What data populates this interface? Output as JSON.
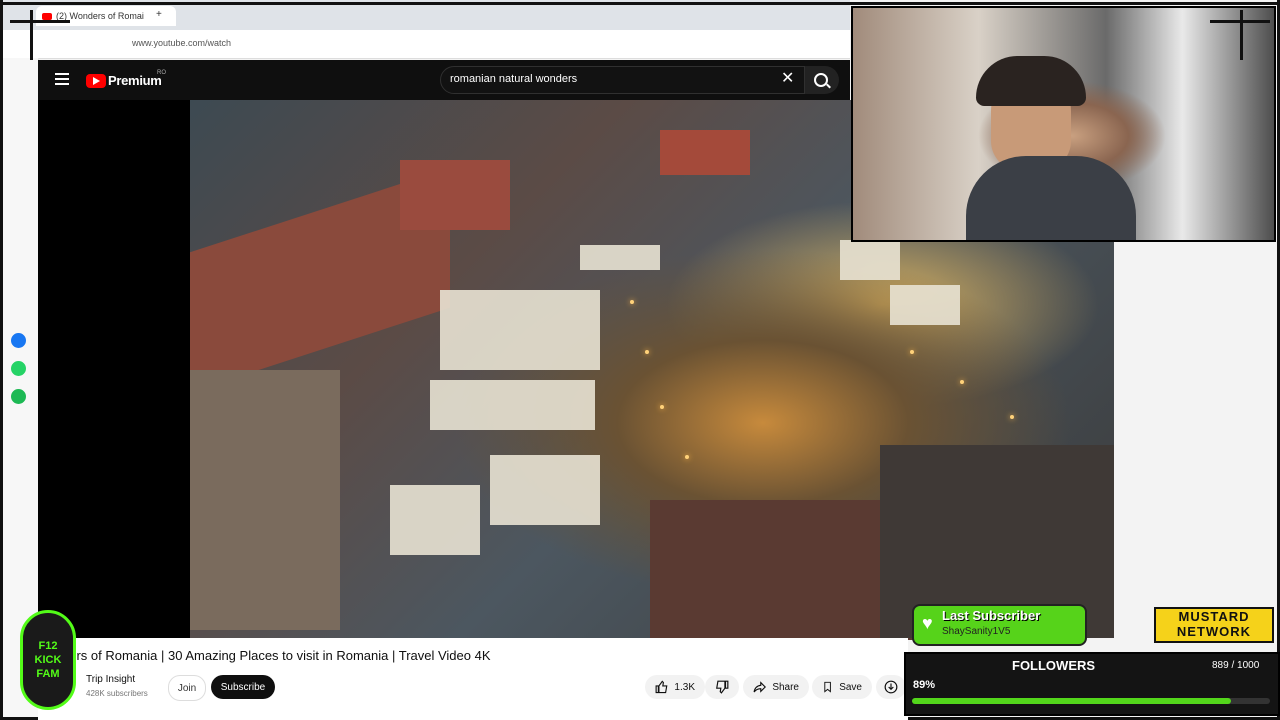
{
  "browser": {
    "tab_title": "(2) Wonders of Romai",
    "new_tab": "+",
    "url": "www.youtube.com/watch"
  },
  "youtube": {
    "brand": "Premium",
    "region": "RO",
    "search_query": "romanian natural wonders",
    "video_title": "ders of Romania | 30 Amazing Places to visit in Romania | Travel Video 4K",
    "channel_name": "Trip Insight",
    "subscribers": "428K subscribers",
    "join_label": "Join",
    "subscribe_label": "Subscribe",
    "likes": "1.3K",
    "share_label": "Share",
    "save_label": "Save"
  },
  "overlay": {
    "kick_badge_line1": "F12",
    "kick_badge_line2": "KICK FAM",
    "last_subscriber_title": "Last Subscriber",
    "last_subscriber_name": "ShaySanity1V5",
    "mustard_logo_line1": "MUSTARD",
    "mustard_logo_line2": "NETWORK",
    "followers_title": "FOLLOWERS",
    "followers_count": "889 / 1000",
    "followers_percent": "89%",
    "followers_progress": 0.89
  },
  "colors": {
    "youtube_red": "#ff0000",
    "kick_green": "#53fc18",
    "mustard_yellow": "#f5d21a"
  },
  "icons": [
    "menu-icon",
    "search-icon",
    "clear-icon",
    "like-icon",
    "dislike-icon",
    "share-icon",
    "save-icon",
    "download-icon",
    "messenger-icon",
    "whatsapp-icon",
    "spotify-icon",
    "heart-icon"
  ]
}
